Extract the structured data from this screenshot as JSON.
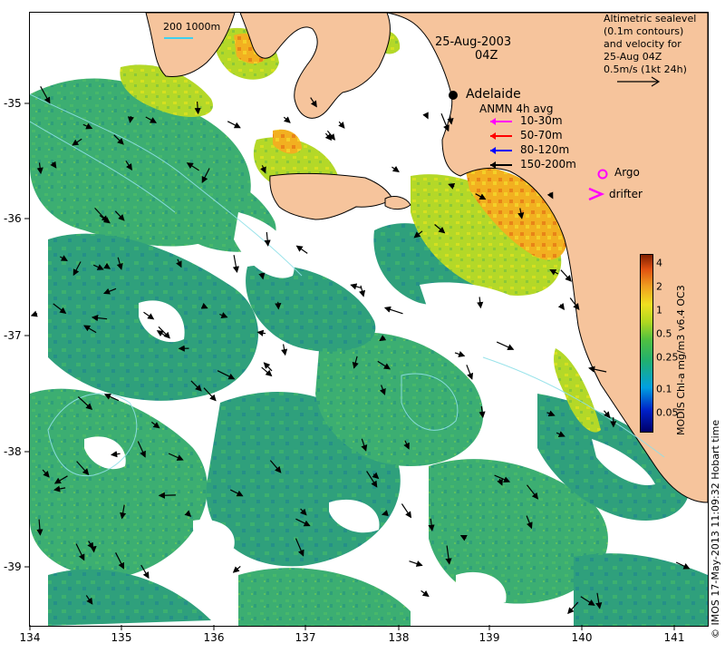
{
  "map": {
    "date": "25-Aug-2003",
    "time": "04Z",
    "city_label": "Adelaide",
    "scale_label": "200  1000m",
    "altimetry_note": [
      "Altimetric sealevel",
      "(0.1m contours)",
      "and velocity for",
      "25-Aug 04Z",
      "0.5m/s (1kt 24h)"
    ],
    "anmn_title": "ANMN 4h avg",
    "anmn_legend": [
      {
        "label": "10-30m",
        "color": "#ff00ff"
      },
      {
        "label": "50-70m",
        "color": "#ff0000"
      },
      {
        "label": "80-120m",
        "color": "#0000ff"
      },
      {
        "label": "150-200m",
        "color": "#000000"
      }
    ],
    "argo_label": "Argo",
    "drifter_label": "drifter",
    "colorbar_title": "MODIS Chl-a mg/m3 v6.4 OC3",
    "colorbar_ticks": [
      "4",
      "2",
      "1",
      "0.5",
      "0.25",
      "0.1",
      "0.05"
    ],
    "x_ticks": [
      "134",
      "135",
      "136",
      "137",
      "138",
      "139",
      "140",
      "141"
    ],
    "y_ticks": [
      "-35",
      "-36",
      "-37",
      "-38",
      "-39"
    ],
    "credit": "© IMOS 17-May-2013 11:09:32 Hobart time",
    "colors": {
      "land": "#f6c49c",
      "ocean_chl": "#3aaa6e",
      "coastal_chl": "#b8dc2a",
      "high_chl": "#f0a020"
    }
  }
}
